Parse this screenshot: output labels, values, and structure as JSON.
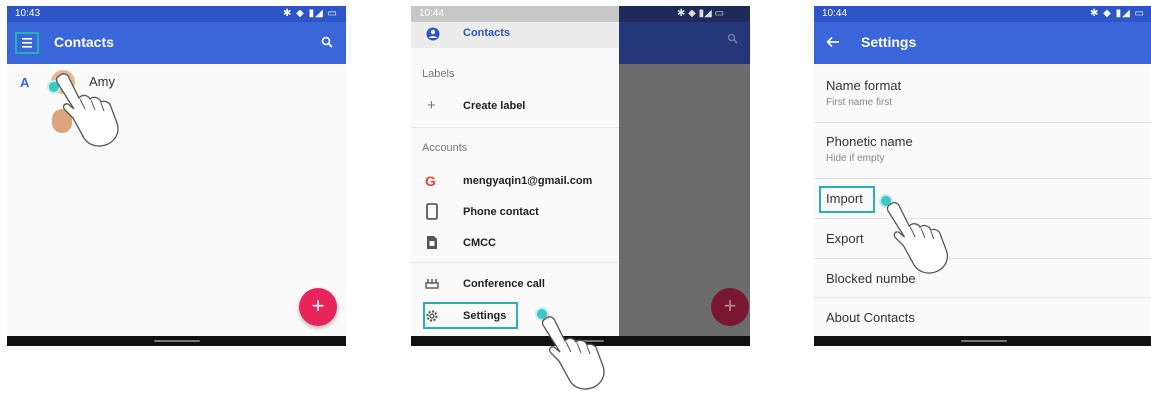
{
  "screen1": {
    "status_time": "10:43",
    "app_title": "Contacts",
    "section_letter": "A",
    "contact_name": "Amy",
    "icons": [
      "menu-icon",
      "search-icon",
      "add-icon"
    ]
  },
  "screen2": {
    "status_time": "10:44",
    "drawer_contacts": "Contacts",
    "labels_header": "Labels",
    "create_label": "Create label",
    "accounts_header": "Accounts",
    "account_google": "mengyaqin1@gmail.com",
    "account_phone": "Phone contact",
    "account_sim": "CMCC",
    "conference_call": "Conference call",
    "settings": "Settings",
    "icons": [
      "account-icon",
      "plus-icon",
      "google-icon",
      "phone-icon",
      "sim-icon",
      "conference-icon",
      "gear-icon"
    ]
  },
  "screen3": {
    "status_time": "10:44",
    "app_title": "Settings",
    "name_format": "Name format",
    "name_format_value": "First name first",
    "phonetic_name": "Phonetic name",
    "phonetic_name_value": "Hide if empty",
    "import": "Import",
    "export": "Export",
    "blocked_numbers": "Blocked numbe",
    "about": "About Contacts",
    "icons": [
      "back-arrow-icon"
    ]
  },
  "colors": {
    "appbar": "#3a66d9",
    "statusbar": "#2d55c6",
    "fab": "#e8245a",
    "highlight": "#27b0b8"
  }
}
